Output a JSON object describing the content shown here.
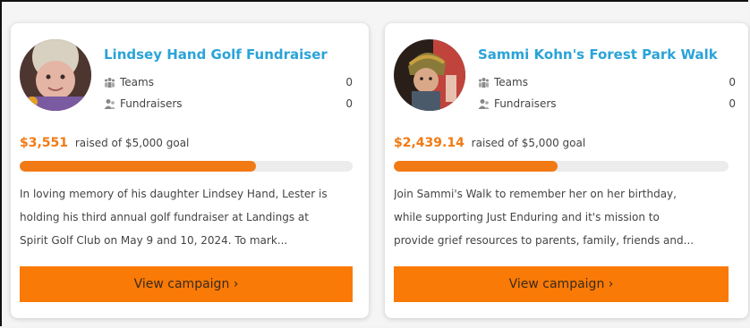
{
  "colors": {
    "accent": "#f27a14",
    "title": "#2aa3d8",
    "button": "#f97a06",
    "track": "#ececec"
  },
  "campaigns": [
    {
      "title": "Lindsey Hand Golf Fundraiser",
      "teams_label": "Teams",
      "teams_count": "0",
      "fundraisers_label": "Fundraisers",
      "fundraisers_count": "0",
      "raised_amount": "$3,551",
      "raised_suffix": "raised of $5,000 goal",
      "progress_fraction": 0.71,
      "description_lines": [
        "In loving memory of his daughter Lindsey Hand, Lester is",
        "holding his third annual golf fundraiser at Landings at",
        "Spirit Golf Club on May 9 and 10, 2024. To mark..."
      ],
      "button_label": "View campaign ›",
      "avatar_icon": "portrait-photo"
    },
    {
      "title": "Sammi Kohn's Forest Park Walk",
      "teams_label": "Teams",
      "teams_count": "0",
      "fundraisers_label": "Fundraisers",
      "fundraisers_count": "0",
      "raised_amount": "$2,439.14",
      "raised_suffix": "raised of $5,000 goal",
      "progress_fraction": 0.49,
      "description_lines": [
        "Join Sammi's Walk to remember her on her birthday,",
        "while supporting Just Enduring and it's mission to",
        "provide grief resources to parents, family, friends and..."
      ],
      "button_label": "View campaign ›",
      "avatar_icon": "portrait-photo"
    }
  ]
}
